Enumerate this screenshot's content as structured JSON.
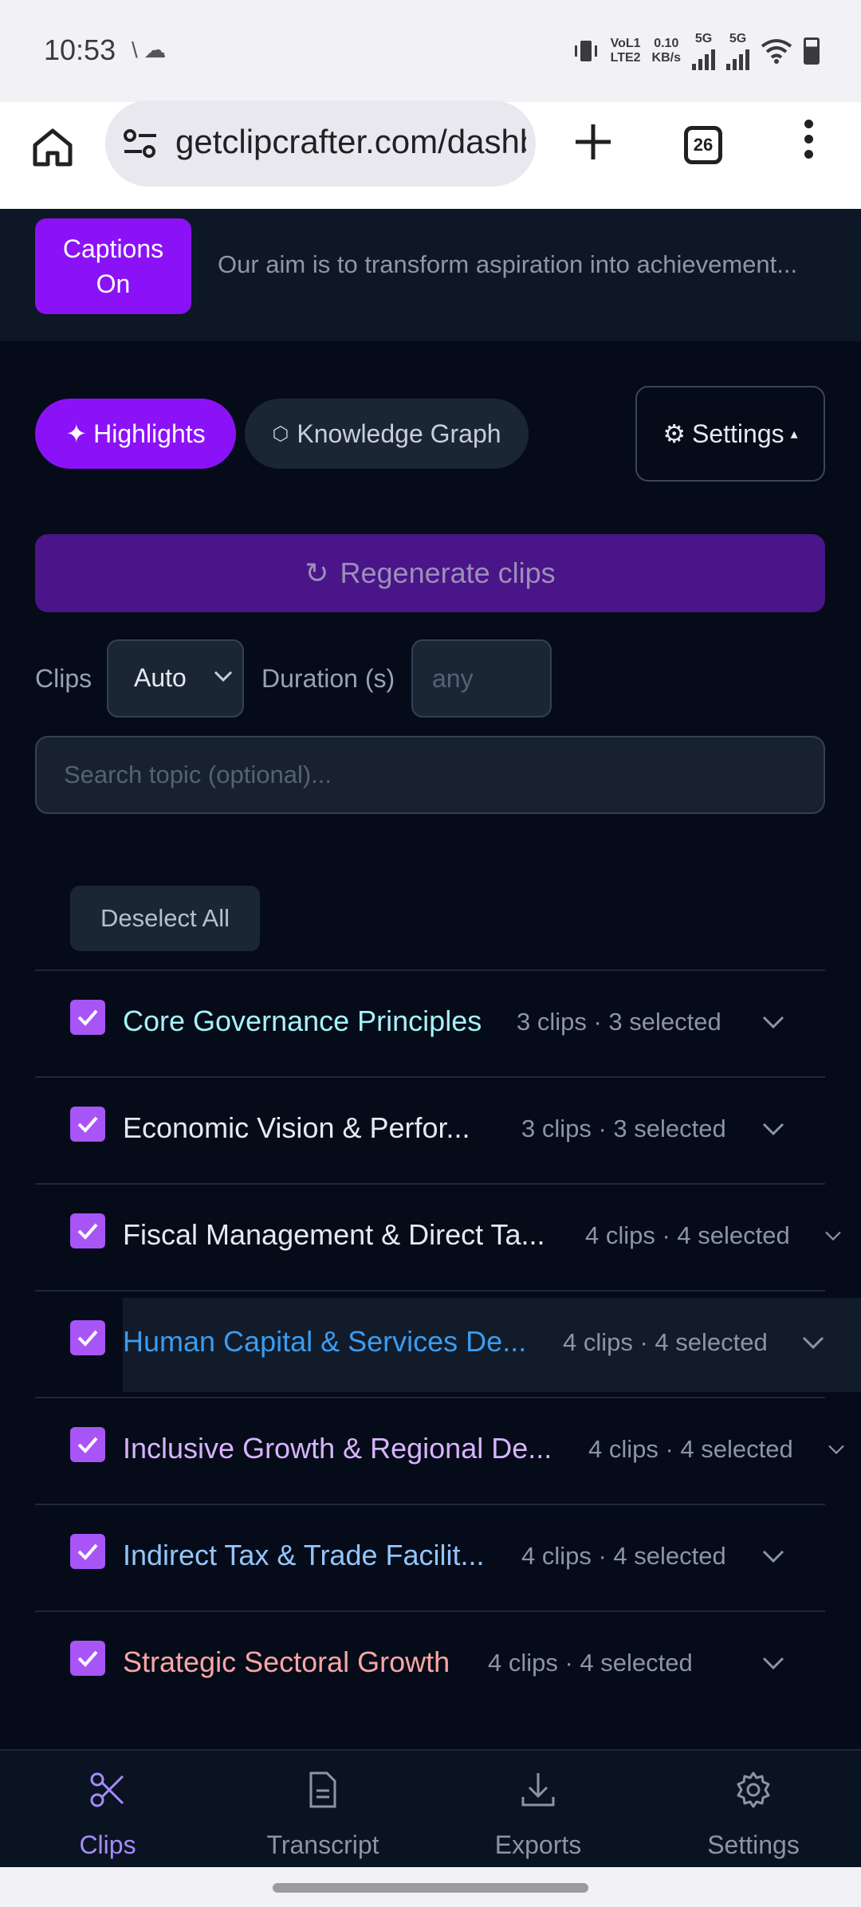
{
  "status_bar": {
    "time": "10:53",
    "left_icons": "\\ ☁",
    "volte": "VoL1",
    "lte": "LTE2",
    "speed_value": "0.10",
    "speed_unit": "KB/s",
    "net1": "5G",
    "net2": "5G"
  },
  "browser": {
    "url": "getclipcrafter.com/dashboard",
    "tab_count": "26"
  },
  "captions": {
    "button_line1": "Captions",
    "button_line2": "On",
    "text": "Our aim is to transform aspiration into achievement..."
  },
  "modes": {
    "highlights_icon": "✦",
    "highlights_label": "Highlights",
    "knowledge_graph_icon": "⬡",
    "knowledge_graph_label": "Knowledge Graph",
    "settings_icon": "⚙",
    "settings_label": "Settings",
    "settings_caret": "▴"
  },
  "regenerate": {
    "icon": "↻",
    "label": "Regenerate clips"
  },
  "controls": {
    "clips_label": "Clips",
    "clips_value": "Auto",
    "duration_label": "Duration (s)",
    "duration_placeholder": "any",
    "search_placeholder": "Search topic (optional)..."
  },
  "deselect_label": "Deselect All",
  "topics": [
    {
      "title": "Core Governance Principles",
      "meta": "3 clips · 3 selected",
      "color": "#a5f3fc"
    },
    {
      "title": "Economic Vision & Perfor...",
      "meta": "3 clips · 3 selected",
      "color": "#e6e9f0"
    },
    {
      "title": "Fiscal Management & Direct Ta...",
      "meta": "4 clips · 4 selected",
      "color": "#e6e9f0"
    },
    {
      "title": "Human Capital & Services De...",
      "meta": "4 clips · 4 selected",
      "color": "#3b9cf0"
    },
    {
      "title": "Inclusive Growth & Regional De...",
      "meta": "4 clips · 4 selected",
      "color": "#d8b4fe"
    },
    {
      "title": "Indirect Tax & Trade Facilit...",
      "meta": "4 clips · 4 selected",
      "color": "#93c5fd"
    },
    {
      "title": "Strategic Sectoral Growth",
      "meta": "4 clips · 4 selected",
      "color": "#fca5a5"
    }
  ],
  "bottom_nav": {
    "clips": "Clips",
    "transcript": "Transcript",
    "exports": "Exports",
    "settings": "Settings"
  },
  "colors": {
    "accent": "#8b12f7",
    "active_nav": "#a78bfa",
    "background": "#050b18"
  }
}
